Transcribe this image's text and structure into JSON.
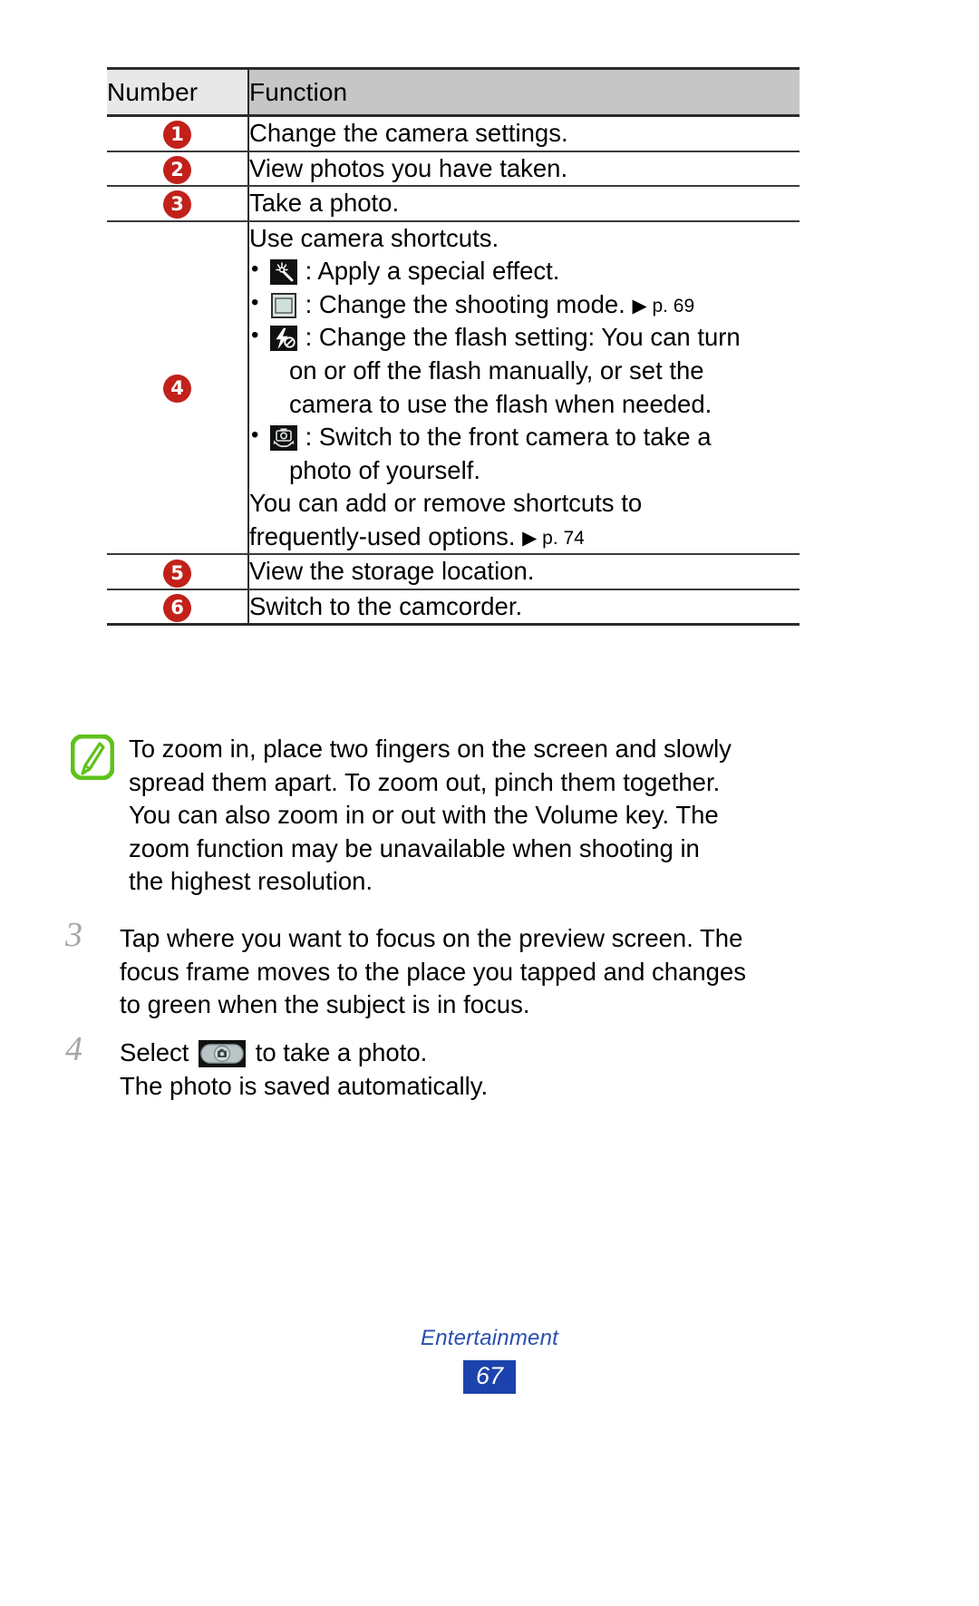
{
  "table": {
    "headers": [
      "Number",
      "Function"
    ],
    "rows": [
      {
        "number": "1",
        "text": "Change the camera settings."
      },
      {
        "number": "2",
        "text": "View photos you have taken."
      },
      {
        "number": "3",
        "text": "Take a photo."
      },
      {
        "number": "4",
        "intro": "Use camera shortcuts.",
        "bullets": [
          {
            "icon": "special-effect-icon",
            "text": ": Apply a special effect."
          },
          {
            "icon": "shooting-mode-icon",
            "text": ": Change the shooting mode. ",
            "ref": "▶ p. 69"
          },
          {
            "icon": "flash-setting-icon",
            "text": ": Change the flash setting: You can turn",
            "cont": [
              "on or off the flash manually, or set the",
              "camera to use the flash when needed."
            ]
          },
          {
            "icon": "front-camera-icon",
            "text": ": Switch to the front camera to take a",
            "cont": [
              "photo of yourself."
            ]
          }
        ],
        "outro_line1": "You can add or remove shortcuts to",
        "outro_line2": "frequently-used options. ",
        "outro_ref": "▶ p. 74"
      },
      {
        "number": "5",
        "text": "View the storage location."
      },
      {
        "number": "6",
        "text": "Switch to the camcorder."
      }
    ]
  },
  "note": {
    "icon": "note-pencil-icon",
    "lines": [
      "To zoom in, place two fingers on the screen and slowly",
      "spread them apart. To zoom out, pinch them together.",
      "You can also zoom in or out with the Volume key. The",
      "zoom function may be unavailable when shooting in",
      "the highest resolution."
    ]
  },
  "steps": [
    {
      "number": "3",
      "lines": [
        "Tap where you want to focus on the preview screen. The",
        "focus frame moves to the place you tapped and changes",
        "to green when the subject is in focus."
      ]
    },
    {
      "number": "4",
      "prefix": "Select ",
      "icon": "shutter-button-icon",
      "suffix": " to take a photo.",
      "line2": "The photo is saved automatically."
    }
  ],
  "footer": {
    "title": "Entertainment",
    "page": "67"
  },
  "colors": {
    "badge_red": "#c1211a",
    "footer_blue": "#1c43ad",
    "note_green": "#5ec21a",
    "header_light": "#e8e8e8",
    "header_dark": "#c6c6c6"
  }
}
